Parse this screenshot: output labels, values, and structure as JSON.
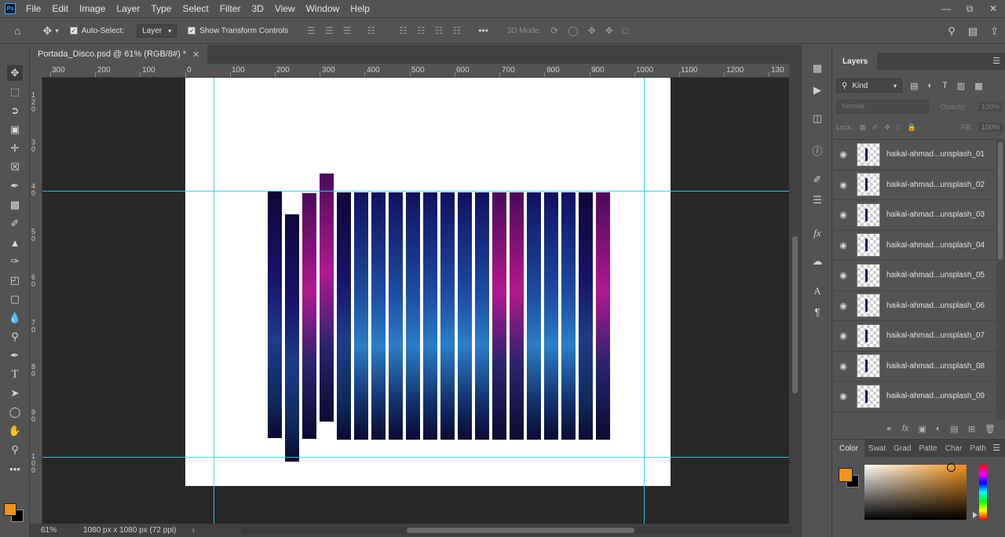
{
  "menu": {
    "logo": "Ps",
    "items": [
      "File",
      "Edit",
      "Image",
      "Layer",
      "Type",
      "Select",
      "Filter",
      "3D",
      "View",
      "Window",
      "Help"
    ]
  },
  "options": {
    "auto_select_label": "Auto-Select:",
    "auto_select_checked": true,
    "target_value": "Layer",
    "show_transform_label": "Show Transform Controls",
    "show_transform_checked": true,
    "mode_3d_label": "3D Mode:"
  },
  "document": {
    "tab_title": "Portada_Disco.psd @ 61% (RGB/8#) *",
    "zoom": "61%",
    "doc_info": "1080 px x 1080 px (72 ppi)"
  },
  "ruler": {
    "top_labels": [
      "300",
      "200",
      "100",
      "0",
      "100",
      "200",
      "300",
      "400",
      "500",
      "600",
      "700",
      "800",
      "900",
      "1000",
      "1100",
      "1200",
      "130"
    ],
    "left_labels": [
      "1\n2\n0",
      "3\n0",
      "4\n0",
      "5\n0",
      "6\n0",
      "7\n0",
      "8\n0",
      "9\n0",
      "1\n0\n0"
    ]
  },
  "layers_panel": {
    "tab_label": "Layers",
    "filter_kind": "Kind",
    "blend_mode": "Normal",
    "opacity_label": "Opacity:",
    "opacity_value": "100%",
    "lock_label": "Lock:",
    "fill_label": "Fill:",
    "fill_value": "100%",
    "layers": [
      "haikal-ahmad...unsplash_01",
      "haikal-ahmad...unsplash_02",
      "haikal-ahmad...unsplash_03",
      "haikal-ahmad...unsplash_04",
      "haikal-ahmad...unsplash_05",
      "haikal-ahmad...unsplash_06",
      "haikal-ahmad...unsplash_07",
      "haikal-ahmad...unsplash_08",
      "haikal-ahmad...unsplash_09"
    ]
  },
  "color_panel": {
    "tabs": [
      "Color",
      "Swat",
      "Grad",
      "Patte",
      "Char",
      "Path"
    ],
    "foreground": "#f0931b",
    "background": "#000000"
  },
  "icons": {
    "move": "move-tool-icon",
    "home": "home-icon",
    "search": "search-icon",
    "eye": "eye-icon"
  }
}
